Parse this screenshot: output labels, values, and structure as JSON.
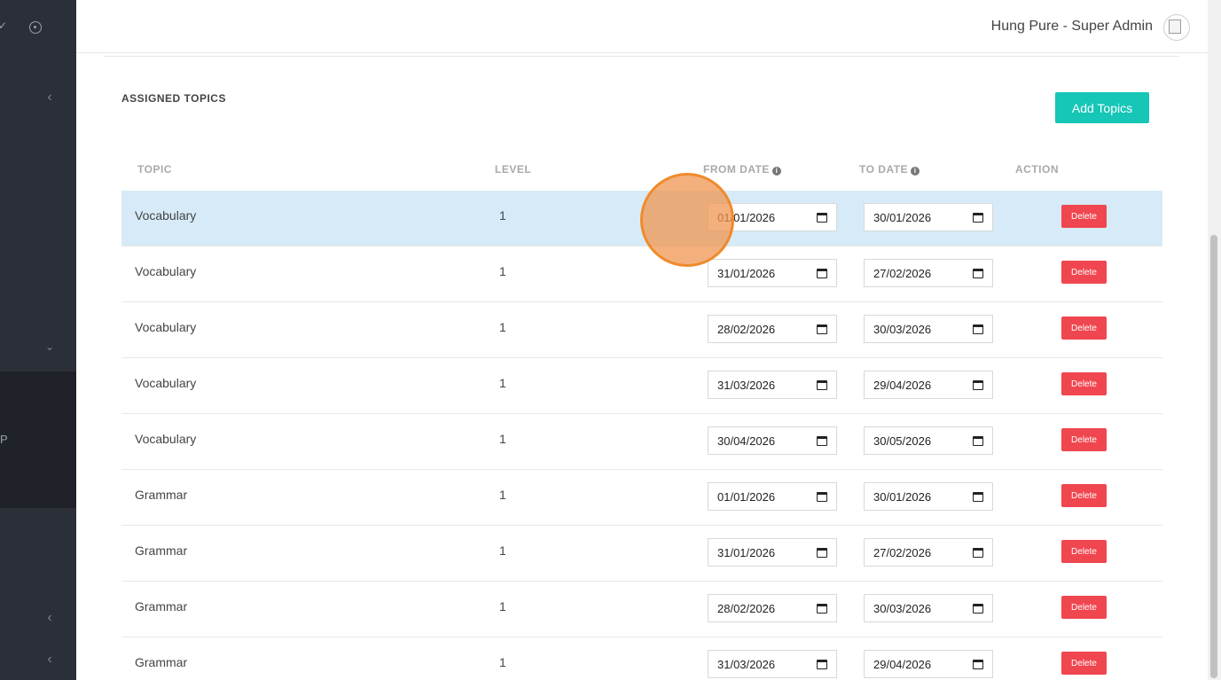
{
  "header": {
    "user_name": "Hung Pure - Super Admin"
  },
  "section": {
    "title": "ASSIGNED TOPICS",
    "add_button": "Add Topics"
  },
  "table": {
    "columns": [
      "TOPIC",
      "LEVEL",
      "FROM DATE",
      "TO DATE",
      "ACTION"
    ],
    "rows": [
      {
        "topic": "Vocabulary",
        "level": "1",
        "from": "01/01/2026",
        "to": "30/01/2026",
        "action": "Delete"
      },
      {
        "topic": "Vocabulary",
        "level": "1",
        "from": "31/01/2026",
        "to": "27/02/2026",
        "action": "Delete"
      },
      {
        "topic": "Vocabulary",
        "level": "1",
        "from": "28/02/2026",
        "to": "30/03/2026",
        "action": "Delete"
      },
      {
        "topic": "Vocabulary",
        "level": "1",
        "from": "31/03/2026",
        "to": "29/04/2026",
        "action": "Delete"
      },
      {
        "topic": "Vocabulary",
        "level": "1",
        "from": "30/04/2026",
        "to": "30/05/2026",
        "action": "Delete"
      },
      {
        "topic": "Grammar",
        "level": "1",
        "from": "01/01/2026",
        "to": "30/01/2026",
        "action": "Delete"
      },
      {
        "topic": "Grammar",
        "level": "1",
        "from": "31/01/2026",
        "to": "27/02/2026",
        "action": "Delete"
      },
      {
        "topic": "Grammar",
        "level": "1",
        "from": "28/02/2026",
        "to": "30/03/2026",
        "action": "Delete"
      },
      {
        "topic": "Grammar",
        "level": "1",
        "from": "31/03/2026",
        "to": "29/04/2026",
        "action": "Delete"
      }
    ]
  },
  "sidebar": {
    "letter": "P"
  },
  "icons": {
    "info": "info-icon",
    "calendar": "calendar-icon",
    "chevron": "chevron-left-icon"
  },
  "colors": {
    "accent": "#16c6b6",
    "danger": "#f0464f",
    "selected_row": "#d6ebf7",
    "sidebar": "#2b3038"
  }
}
